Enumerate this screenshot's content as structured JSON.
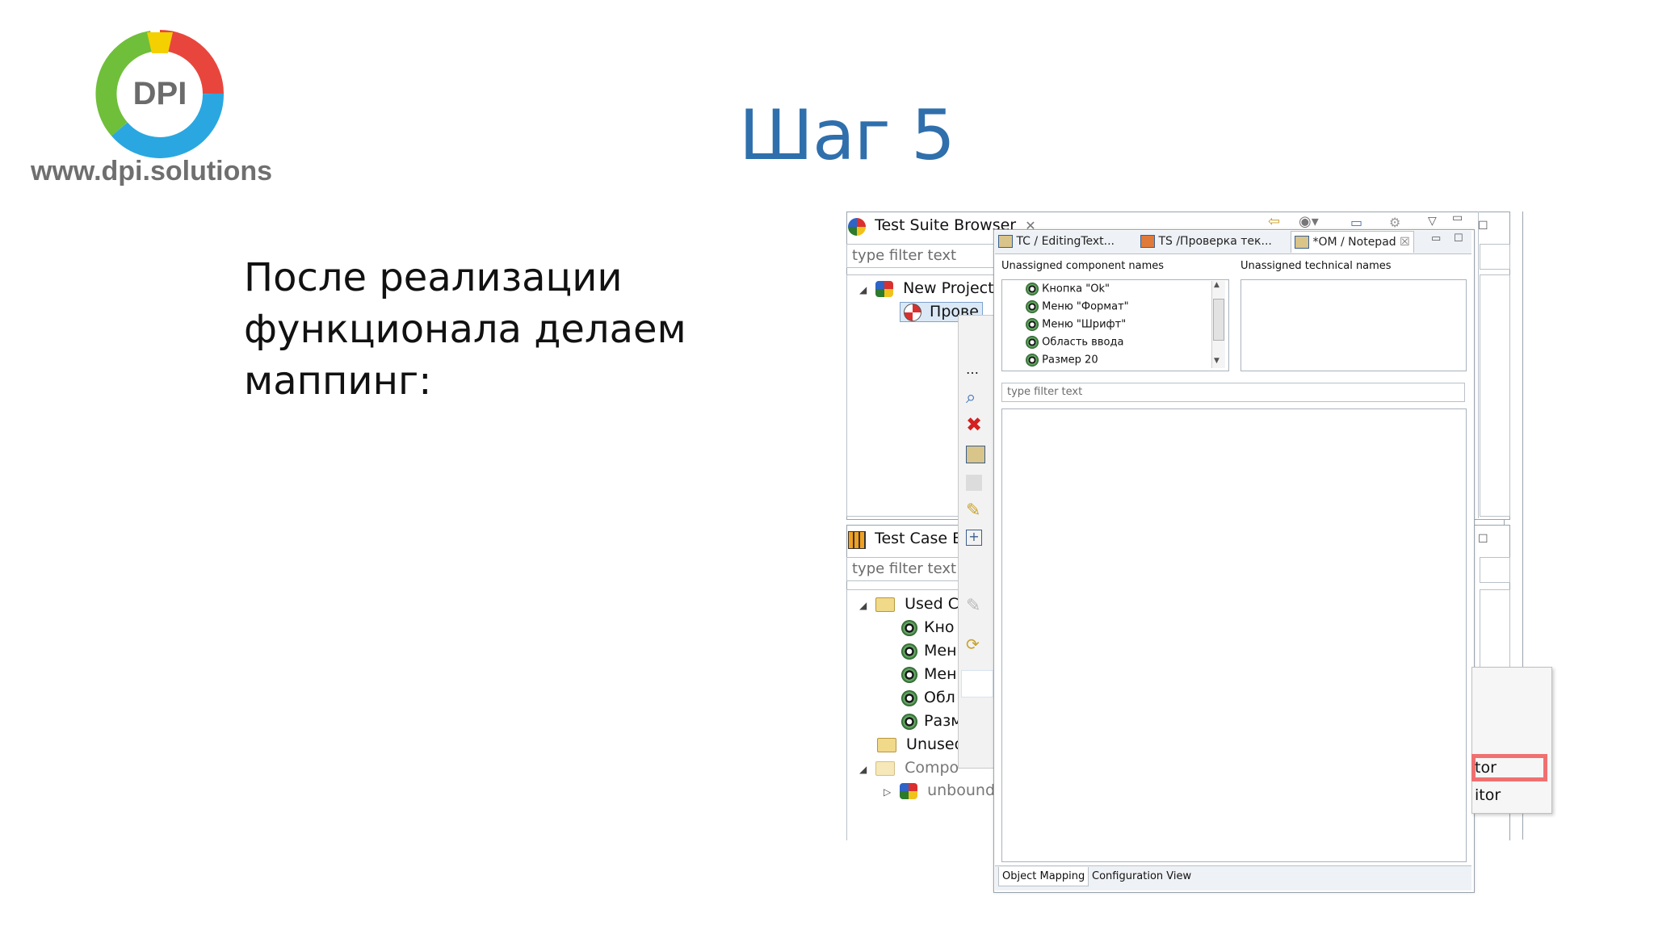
{
  "logo": {
    "text": "DPI",
    "site": "www.dpi.solutions"
  },
  "slide": {
    "title": "Шаг 5",
    "body": "После реализации функционала делаем маппинг:"
  },
  "suite_browser": {
    "title": "Test Suite Browser",
    "filter": "type filter text",
    "project": "New Project",
    "item": "Прове"
  },
  "case_browser": {
    "title": "Test Case Br",
    "filter": "type filter text",
    "used": "Used Co",
    "items": [
      "Кно",
      "Мен",
      "Мен",
      "Обл",
      "Разм"
    ],
    "unused": "Unused",
    "comp": "Compo",
    "unbound": "unbound"
  },
  "editor": {
    "tabs": [
      "TC / EditingText...",
      "TS /Проверка тек...",
      "*OM / Notepad"
    ],
    "unassigned_component_label": "Unassigned component names",
    "unassigned_technical_label": "Unassigned technical names",
    "components": [
      "Кнопка \"Ok\"",
      "Меню \"Формат\"",
      "Меню \"Шрифт\"",
      "Область ввода",
      "Размер 20"
    ],
    "filter": "type filter text",
    "bottom_tabs": [
      "Object Mapping",
      "Configuration View"
    ]
  },
  "popup": {
    "items": [
      "tor",
      "itor"
    ]
  },
  "colors": {
    "title": "#2f6fac",
    "logo_green": "#6fbf3a",
    "logo_red": "#e8463d",
    "logo_blue": "#2aa7e0",
    "logo_yellow": "#f4d000",
    "highlight": "#f07070"
  }
}
